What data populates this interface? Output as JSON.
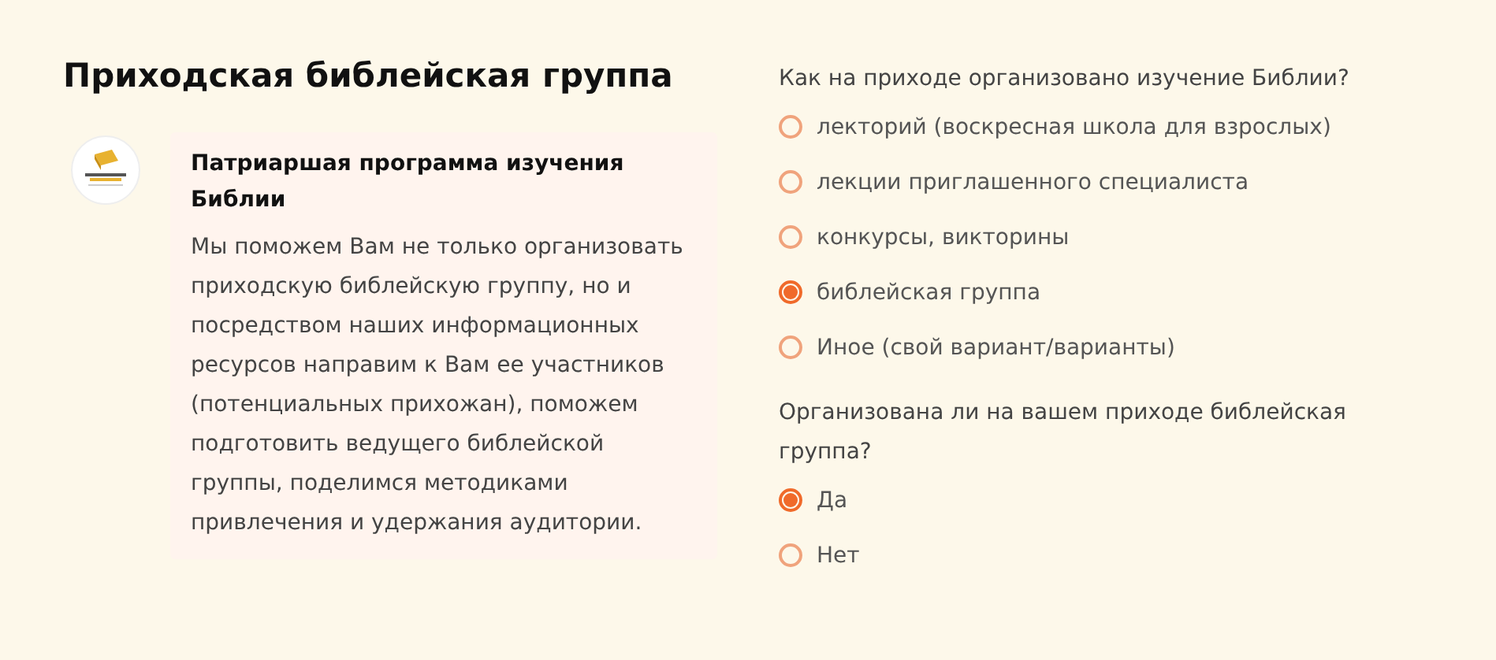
{
  "title": "Приходская библейская группа",
  "card": {
    "heading": "Патриаршая программа изучения Библии",
    "text": "Мы поможем Вам не только организовать приходскую библейскую группу, но и посредством наших информационных ресурсов направим к Вам ее участников (потенциальных прихожан), поможем подготовить ведущего библейской группы, поделимся методиками привлечения и удержания аудитории."
  },
  "questions": [
    {
      "label": "Как на приходе организовано изучение Библии?",
      "options": [
        {
          "label": "лекторий (воскресная школа для взрослых)",
          "selected": false
        },
        {
          "label": "лекции приглашенного специалиста",
          "selected": false
        },
        {
          "label": "конкурсы, викторины",
          "selected": false
        },
        {
          "label": "библейская группа",
          "selected": true
        },
        {
          "label": "Иное (свой вариант/варианты)",
          "selected": false
        }
      ]
    },
    {
      "label": "Организована ли на вашем приходе библейская группа?",
      "options": [
        {
          "label": "Да",
          "selected": true
        },
        {
          "label": "Нет",
          "selected": false
        }
      ]
    }
  ]
}
